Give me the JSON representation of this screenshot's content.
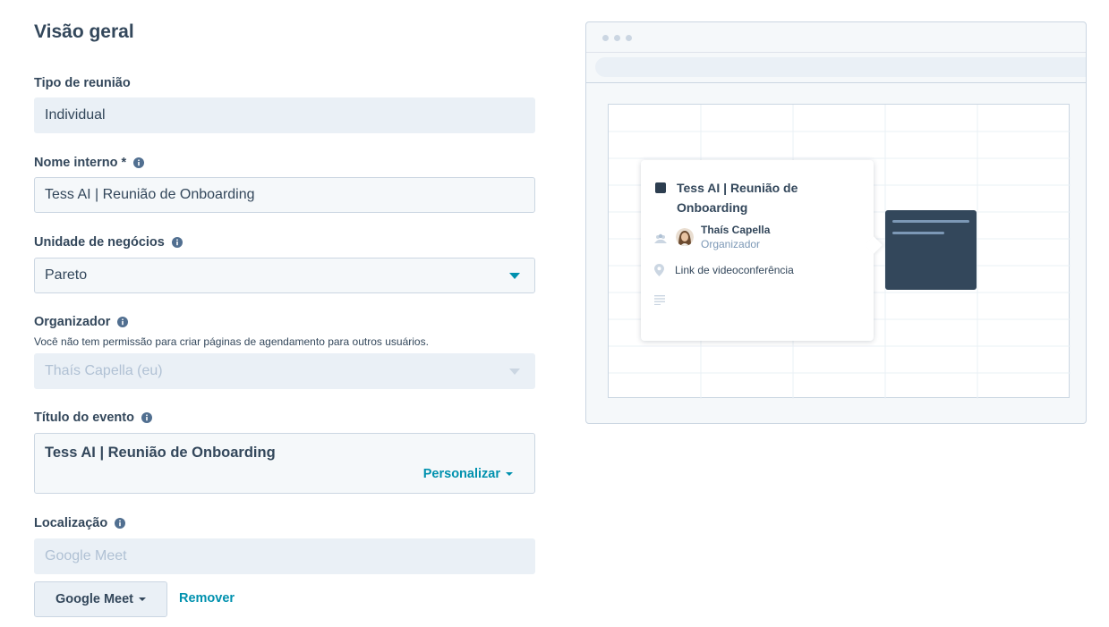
{
  "page": {
    "title": "Visão geral"
  },
  "form": {
    "meeting_type": {
      "label": "Tipo de reunião",
      "value": "Individual"
    },
    "internal_name": {
      "label": "Nome interno *",
      "value": "Tess AI | Reunião de Onboarding"
    },
    "business_unit": {
      "label": "Unidade de negócios",
      "value": "Pareto"
    },
    "organizer": {
      "label": "Organizador",
      "note": "Você não tem permissão para criar páginas de agendamento para outros usuários.",
      "value": "Thaís Capella (eu)"
    },
    "event_title": {
      "label": "Título do evento",
      "value": "Tess AI | Reunião de Onboarding",
      "customize_label": "Personalizar"
    },
    "location": {
      "label": "Localização",
      "placeholder": "Google Meet",
      "button_label": "Google Meet",
      "remove_label": "Remover"
    }
  },
  "preview": {
    "event_title": "Tess AI | Reunião de Onboarding",
    "organizer_name": "Thaís Capella",
    "organizer_role": "Organizador",
    "location_text": "Link de videoconferência"
  },
  "colors": {
    "accent": "#0091ae",
    "text": "#33475b",
    "event_block": "#33475b",
    "field_bg": "#eaf0f6",
    "border": "#cbd6e2"
  },
  "icons": [
    "info-icon",
    "chevron-down-icon",
    "people-icon",
    "location-pin-icon",
    "description-icon"
  ]
}
